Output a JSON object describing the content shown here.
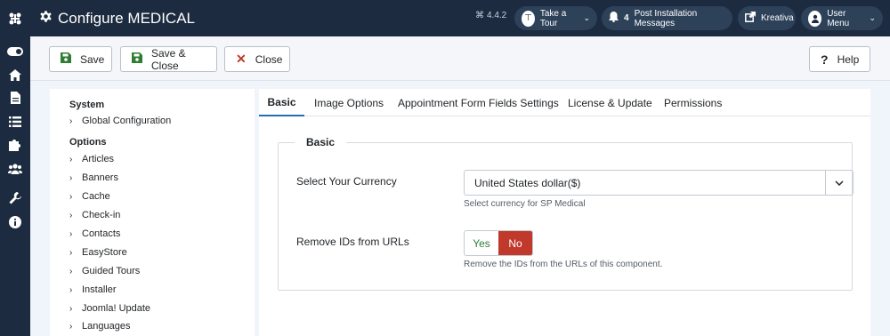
{
  "header": {
    "title": "Configure MEDICAL",
    "version": "4.4.2",
    "take_tour": "Take a Tour",
    "messages_count": "4",
    "messages_label": "Post Installation Messages",
    "site_label": "Kreativa",
    "user_menu": "User Menu"
  },
  "toolbar": {
    "save": "Save",
    "save_close": "Save & Close",
    "close": "Close",
    "help": "Help"
  },
  "sidebar": {
    "system_heading": "System",
    "system_items": [
      "Global Configuration"
    ],
    "options_heading": "Options",
    "options_items": [
      "Articles",
      "Banners",
      "Cache",
      "Check-in",
      "Contacts",
      "EasyStore",
      "Guided Tours",
      "Installer",
      "Joomla! Update",
      "Languages"
    ]
  },
  "tabs": [
    "Basic",
    "Image Options",
    "Appointment Form Fields Settings",
    "License & Update",
    "Permissions"
  ],
  "form": {
    "legend": "Basic",
    "currency_label": "Select Your Currency",
    "currency_value": "United States dollar($)",
    "currency_hint": "Select currency for SP Medical",
    "remove_ids_label": "Remove IDs from URLs",
    "yes": "Yes",
    "no": "No",
    "remove_ids_hint": "Remove the IDs from the URLs of this component."
  },
  "colors": {
    "header_bg": "#1c2b3f",
    "tab_active": "#2a69b8",
    "no_active": "#c0392b",
    "yes_text": "#2f7d32"
  }
}
